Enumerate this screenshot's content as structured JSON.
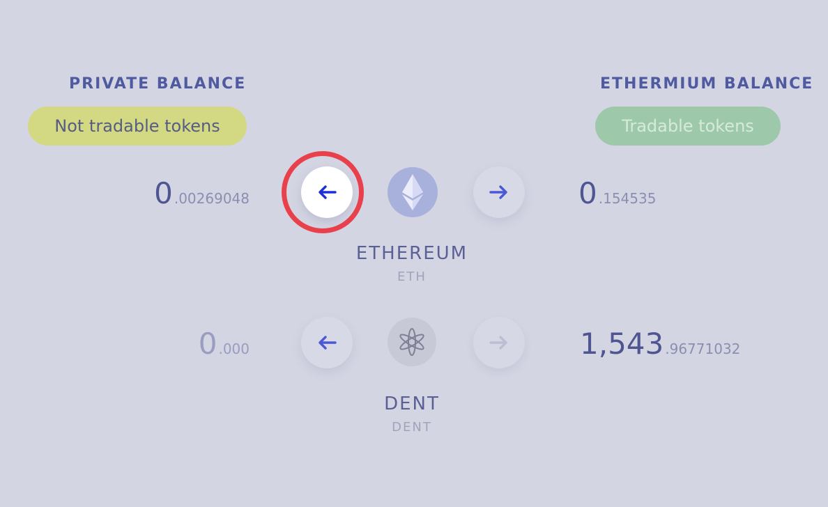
{
  "private": {
    "heading": "PRIVATE BALANCE",
    "pill": "Not tradable tokens"
  },
  "ethermium": {
    "heading": "ETHERMIUM BALANCE",
    "pill": "Tradable tokens"
  },
  "tokens": [
    {
      "name": "ETHEREUM",
      "symbol": "ETH",
      "private_int": "0",
      "private_dec": ".00269048",
      "ethermium_int": "0",
      "ethermium_dec": ".154535",
      "icon": "ethereum-icon"
    },
    {
      "name": "DENT",
      "symbol": "DENT",
      "private_int": "0",
      "private_dec": ".000",
      "ethermium_int": "1,543",
      "ethermium_dec": ".96771032",
      "icon": "dent-icon"
    }
  ],
  "colors": {
    "background": "#d4d5e3",
    "accent": "#4f5aa0",
    "arrow": "#4a58d6",
    "arrow_active": "#1f2fd8",
    "highlight": "#e9414c",
    "private_pill": "#d3d883",
    "ethermium_pill": "#9dc9aa"
  }
}
